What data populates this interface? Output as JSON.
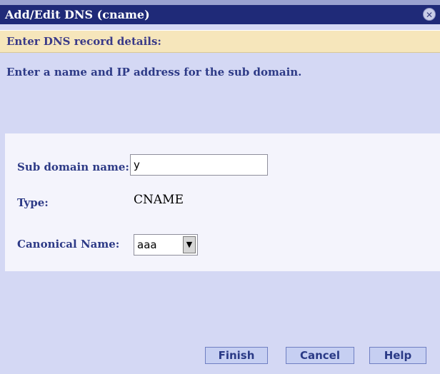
{
  "dialog": {
    "title": "Add/Edit DNS (cname)",
    "close_icon": "close-icon"
  },
  "header": {
    "text": "Enter DNS record details:"
  },
  "intro": {
    "text": "Enter a name and IP address for the sub domain."
  },
  "form": {
    "subdomain_label": "Sub domain name:",
    "subdomain_value": "y",
    "type_label": "Type:",
    "type_value": "CNAME",
    "canonical_label": "Canonical Name:",
    "canonical_value": "aaa"
  },
  "buttons": {
    "finish": "Finish",
    "cancel": "Cancel",
    "help": "Help"
  },
  "colors": {
    "titlebar": "#1f2a78",
    "header_band": "#f6e6bb",
    "panel_bg": "#d4d8f4",
    "form_bg": "#f4f4fc",
    "label_text": "#2d3a86"
  }
}
